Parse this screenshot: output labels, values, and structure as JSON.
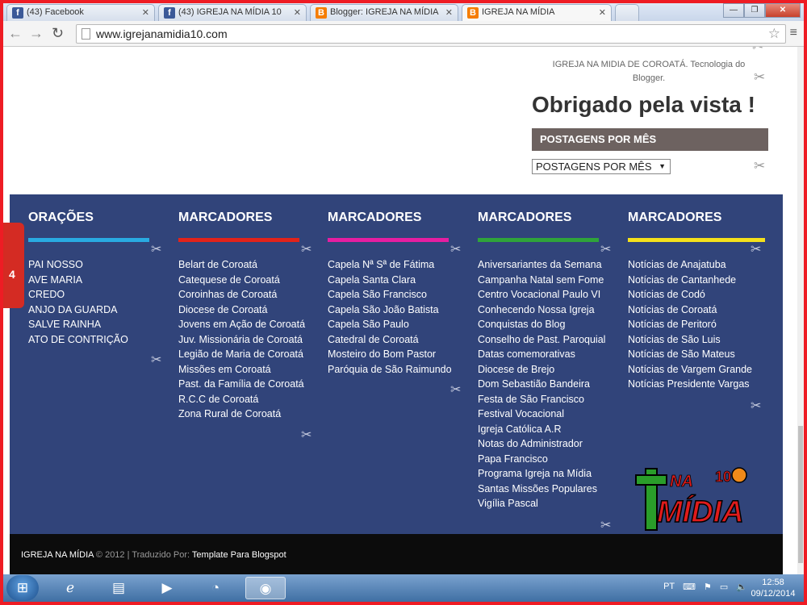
{
  "browser": {
    "tabs": [
      {
        "label": "(43) Facebook",
        "icon": "f"
      },
      {
        "label": "(43) IGREJA NA MÍDIA 10",
        "icon": "f"
      },
      {
        "label": "Blogger: IGREJA NA MÍDIA",
        "icon": "B"
      },
      {
        "label": "IGREJA NA MÍDIA",
        "icon": "B"
      }
    ],
    "url": "www.igrejanamidia10.com"
  },
  "sidebar": {
    "credit_text": "IGREJA NA MIDIA DE COROATÁ. Tecnologia do Blogger.",
    "thanks": "Obrigado pela vista !",
    "archive_header": "POSTAGENS POR MÊS",
    "archive_select": "POSTAGENS POR MÊS"
  },
  "footer": {
    "columns": [
      {
        "title": "ORAÇÕES",
        "color": "#29abe2",
        "items": [
          "PAI NOSSO",
          "AVE MARIA",
          "CREDO",
          "ANJO DA GUARDA",
          "SALVE RAINHA",
          "ATO DE CONTRIÇÃO"
        ]
      },
      {
        "title": "MARCADORES",
        "color": "#e2231a",
        "items": [
          "Belart de Coroatá",
          "Catequese de Coroatá",
          "Coroinhas de Coroatá",
          "Diocese de Coroatá",
          "Jovens em Ação de Coroatá",
          "Juv. Missionária de Coroatá",
          "Legião de Maria de Coroatá",
          "Missões em Coroatá",
          "Past. da Família de Coroatá",
          "R.C.C de Coroatá",
          "Zona Rural de Coroatá"
        ]
      },
      {
        "title": "MARCADORES",
        "color": "#e61ea1",
        "items": [
          "Capela Nª Sª de Fátima",
          "Capela Santa Clara",
          "Capela São Francisco",
          "Capela São João Batista",
          "Capela São Paulo",
          "Catedral de Coroatá",
          "Mosteiro do Bom Pastor",
          "Paróquia de São Raimundo"
        ]
      },
      {
        "title": "MARCADORES",
        "color": "#2fa43a",
        "items": [
          "Aniversariantes da Semana",
          "Campanha Natal sem Fome",
          "Centro Vocacional Paulo VI",
          "Conhecendo Nossa Igreja",
          "Conquistas do Blog",
          "Conselho de Past. Paroquial",
          "Datas comemorativas",
          "Diocese de Brejo",
          "Dom Sebastião Bandeira",
          "Festa de São Francisco",
          "Festival Vocacional",
          "Igreja Católica A.R",
          "Notas do Administrador",
          "Papa Francisco",
          "Programa Igreja na Mídia",
          "Santas Missões Populares",
          "Vigília Pascal"
        ]
      },
      {
        "title": "MARCADORES",
        "color": "#f5e11b",
        "items": [
          "Notícias de Anajatuba",
          "Notícias de Cantanhede",
          "Notícias de Codó",
          "Notícias de Coroatá",
          "Notícias de Peritoró",
          "Notícias de São Luis",
          "Notícias de São Mateus",
          "Notícias de Vargem Grande",
          "Notícias Presidente Vargas"
        ]
      }
    ],
    "copyright_site": "IGREJA NA MÍDIA",
    "copyright_mid": " © 2012 | Traduzido Por: ",
    "copyright_link": "Template Para Blogspot"
  },
  "side_tab": "4",
  "logo": {
    "na": "NA",
    "ten": "10",
    "midia": "MÍDIA"
  },
  "taskbar": {
    "lang": "PT",
    "time": "12:58",
    "date": "09/12/2014"
  },
  "colors": {
    "footer_bg": "#31447a",
    "frame": "#ee1c24"
  }
}
